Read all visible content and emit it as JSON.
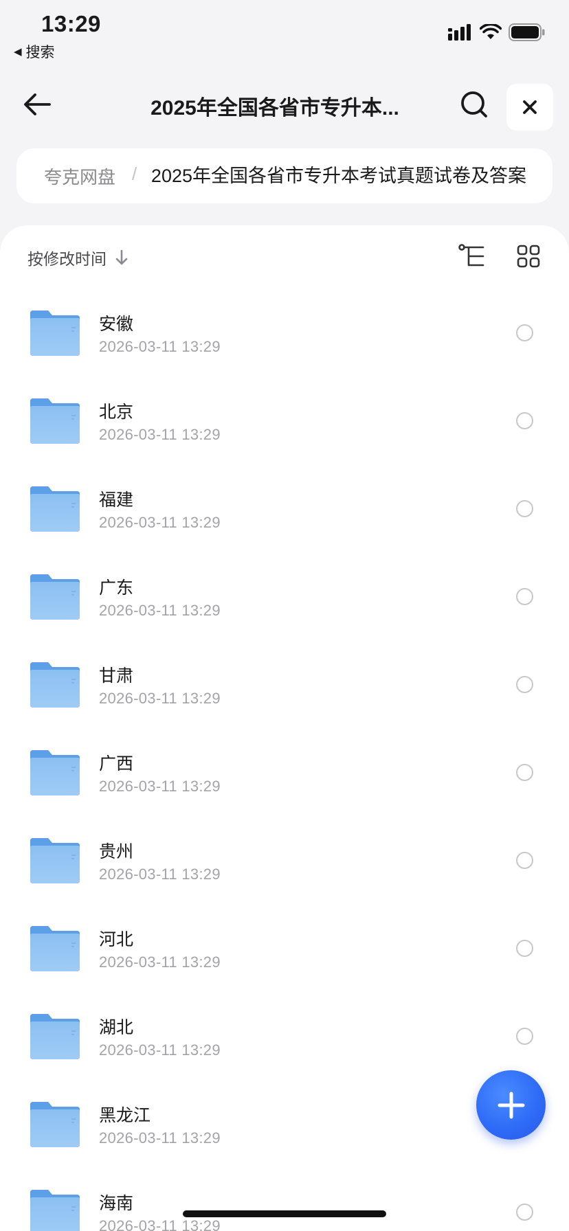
{
  "status_bar": {
    "time": "13:29",
    "back_app_label": "搜索"
  },
  "nav": {
    "title": "2025年全国各省市专升本..."
  },
  "breadcrumb": {
    "root": "夸克网盘",
    "separator": "/",
    "current": "2025年全国各省市专升本考试真题试卷及答案"
  },
  "toolbar": {
    "sort_label": "按修改时间"
  },
  "files": [
    {
      "name": "安徽",
      "date": "2026-03-11 13:29"
    },
    {
      "name": "北京",
      "date": "2026-03-11 13:29"
    },
    {
      "name": "福建",
      "date": "2026-03-11 13:29"
    },
    {
      "name": "广东",
      "date": "2026-03-11 13:29"
    },
    {
      "name": "甘肃",
      "date": "2026-03-11 13:29"
    },
    {
      "name": "广西",
      "date": "2026-03-11 13:29"
    },
    {
      "name": "贵州",
      "date": "2026-03-11 13:29"
    },
    {
      "name": "河北",
      "date": "2026-03-11 13:29"
    },
    {
      "name": "湖北",
      "date": "2026-03-11 13:29"
    },
    {
      "name": "黑龙江",
      "date": "2026-03-11 13:29"
    },
    {
      "name": "海南",
      "date": "2026-03-11 13:29"
    }
  ],
  "icons": {
    "back": "arrow-left-icon",
    "search": "search-icon",
    "close": "close-icon",
    "sort": "arrow-down-icon",
    "tree_view": "tree-view-icon",
    "grid_view": "grid-view-icon",
    "folder": "folder-icon",
    "add": "plus-icon"
  },
  "colors": {
    "accent": "#2f6cf7",
    "folder": "#7fb4ee",
    "background": "#f4f4f6"
  }
}
